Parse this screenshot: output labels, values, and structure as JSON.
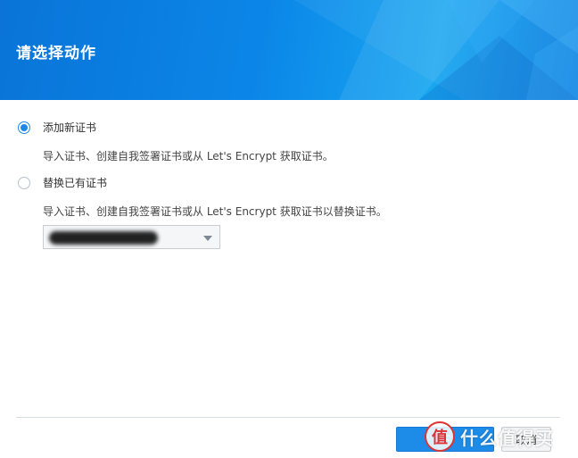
{
  "header": {
    "title": "请选择动作"
  },
  "options": [
    {
      "label": "添加新证书",
      "selected": true,
      "description": "导入证书、创建自我签署证书或从 Let's Encrypt 获取证书。"
    },
    {
      "label": "替换已有证书",
      "selected": false,
      "description": "导入证书、创建自我签署证书或从 Let's Encrypt 获取证书以替换证书。"
    }
  ],
  "certificate_select": {
    "caret_icon": "chevron-down-icon"
  },
  "footer": {
    "next_label": "下",
    "cancel_label": "取消"
  },
  "watermark": {
    "badge": "值",
    "text": "什么值得买"
  },
  "colors": {
    "header_blue": "#0b86e8",
    "accent": "#1e88e5",
    "button_blue": "#1c8ce8"
  }
}
